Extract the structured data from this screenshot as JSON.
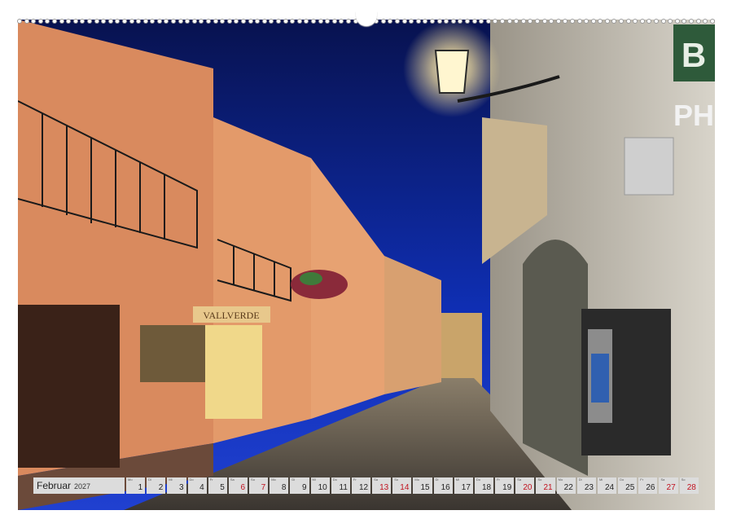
{
  "calendar": {
    "month": "Februar",
    "year": "2027",
    "days": [
      {
        "weekday": "Mo",
        "number": "1",
        "highlight": false
      },
      {
        "weekday": "Di",
        "number": "2",
        "highlight": false
      },
      {
        "weekday": "Mi",
        "number": "3",
        "highlight": false
      },
      {
        "weekday": "Do",
        "number": "4",
        "highlight": false
      },
      {
        "weekday": "Fr",
        "number": "5",
        "highlight": false
      },
      {
        "weekday": "Sa",
        "number": "6",
        "highlight": true
      },
      {
        "weekday": "So",
        "number": "7",
        "highlight": true
      },
      {
        "weekday": "Mo",
        "number": "8",
        "highlight": false
      },
      {
        "weekday": "Di",
        "number": "9",
        "highlight": false
      },
      {
        "weekday": "Mi",
        "number": "10",
        "highlight": false
      },
      {
        "weekday": "Do",
        "number": "11",
        "highlight": false
      },
      {
        "weekday": "Fr",
        "number": "12",
        "highlight": false
      },
      {
        "weekday": "Sa",
        "number": "13",
        "highlight": true
      },
      {
        "weekday": "So",
        "number": "14",
        "highlight": true
      },
      {
        "weekday": "Mo",
        "number": "15",
        "highlight": false
      },
      {
        "weekday": "Di",
        "number": "16",
        "highlight": false
      },
      {
        "weekday": "Mi",
        "number": "17",
        "highlight": false
      },
      {
        "weekday": "Do",
        "number": "18",
        "highlight": false
      },
      {
        "weekday": "Fr",
        "number": "19",
        "highlight": false
      },
      {
        "weekday": "Sa",
        "number": "20",
        "highlight": true
      },
      {
        "weekday": "So",
        "number": "21",
        "highlight": true
      },
      {
        "weekday": "Mo",
        "number": "22",
        "highlight": false
      },
      {
        "weekday": "Di",
        "number": "23",
        "highlight": false
      },
      {
        "weekday": "Mi",
        "number": "24",
        "highlight": false
      },
      {
        "weekday": "Do",
        "number": "25",
        "highlight": false
      },
      {
        "weekday": "Fr",
        "number": "26",
        "highlight": false
      },
      {
        "weekday": "Sa",
        "number": "27",
        "highlight": true
      },
      {
        "weekday": "So",
        "number": "28",
        "highlight": true
      }
    ]
  },
  "photo": {
    "shop_sign": "VALLVERDE",
    "right_sign_top": "B",
    "right_sign_bottom": "PH"
  },
  "colors": {
    "sky": "#0b1a8c",
    "weekend": "#c1121f",
    "strip": "#dcdcdc"
  }
}
